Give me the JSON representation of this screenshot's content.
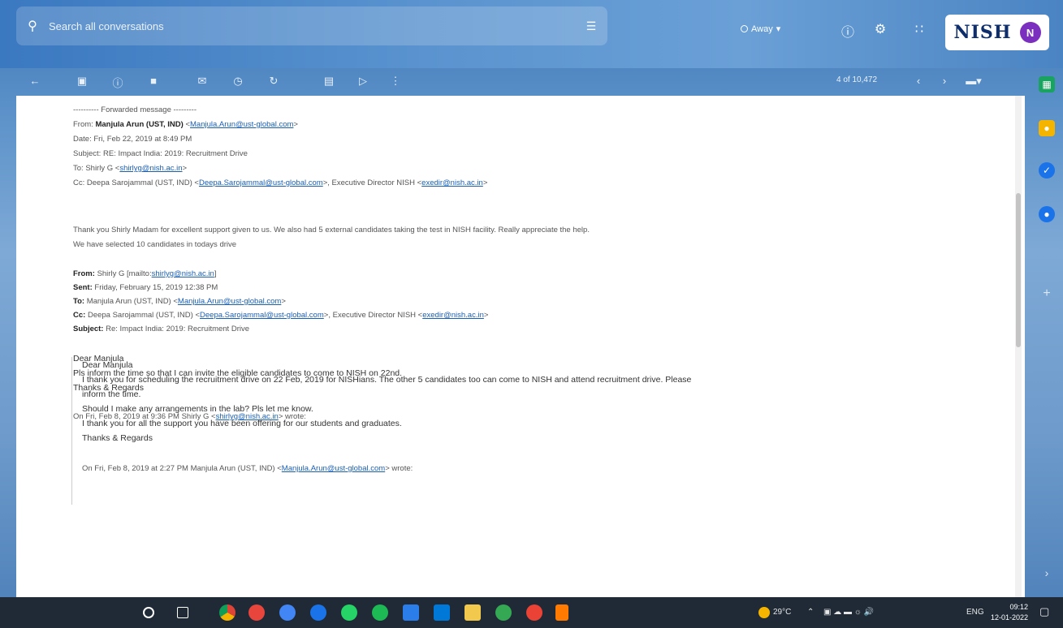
{
  "search": {
    "placeholder": "Search all conversations"
  },
  "status": {
    "label": "Away"
  },
  "brand": {
    "logo_text": "NISH",
    "avatar_letter": "N"
  },
  "toolbar": {
    "pager": "4 of 10,472"
  },
  "header": {
    "forward_marker": "---------- Forwarded message ---------",
    "from_label": "From:",
    "from_name": "Manjula Arun (UST, IND)",
    "from_email": "Manjula.Arun@ust-global.com",
    "date_label": "Date:",
    "date_value": "Fri, Feb 22, 2019 at 8:49 PM",
    "subject_label": "Subject:",
    "subject_value": "RE: Impact India: 2019: Recruitment Drive",
    "to_label": "To:",
    "to_name": "Shirly G",
    "to_email": "shirlyg@nish.ac.in",
    "cc_label": "Cc:",
    "cc_name": "Deepa Sarojammal (UST, IND)",
    "cc_email": "Deepa.Sarojammal@ust-global.com",
    "cc_rest": ", Executive Director NISH",
    "cc_email2": "exedir@nish.ac.in"
  },
  "body": {
    "line1": "Thank you Shirly Madam for excellent support given to us. We also had 5 external candidates taking the test in NISH facility. Really appreciate the help.",
    "line2": "We have selected 10 candidates in todays drive"
  },
  "reply": {
    "from_label": "From:",
    "from_value": "Shirly G [mailto:",
    "from_email": "shirlyg@nish.ac.in",
    "from_end": "]",
    "sent_label": "Sent:",
    "sent_value": "Friday, February 15, 2019 12:38 PM",
    "to_label": "To:",
    "to_value": "Manjula Arun (UST, IND)",
    "to_email": "Manjula.Arun@ust-global.com",
    "cc_label": "Cc:",
    "cc_value": "Deepa Sarojammal (UST, IND)",
    "cc_email": "Deepa.Sarojammal@ust-global.com",
    "cc_rest": ", Executive Director NISH",
    "cc_email2": "exedir@nish.ac.in",
    "subject_label": "Subject:",
    "subject_value": "Re: Impact India: 2019: Recruitment Drive",
    "greeting": "Dear Manjula",
    "text": "Pls inform the time so that I can invite the eligible candidates to come to NISH on 22nd.",
    "signoff": "Thanks & Regards"
  },
  "quote1": {
    "attrib_start": "On Fri, Feb 8, 2019 at 9:36 PM Shirly G <",
    "attrib_email": "shirlyg@nish.ac.in",
    "attrib_end": "> wrote:",
    "greeting": "Dear Manjula",
    "line1": "I thank you for scheduling the recruitment drive on 22 Feb, 2019 for NISHians. The other 5 candidates too can come to NISH and attend recruitment drive. Please",
    "line2": "inform the time.",
    "line3": "Should I make any arrangements in the lab? Pls let me know.",
    "line4": "I thank you for all the support you have been offering for our students and graduates.",
    "signoff": "Thanks & Regards"
  },
  "quote2": {
    "attrib_start": "On Fri, Feb 8, 2019 at 2:27 PM Manjula Arun (UST, IND) <",
    "attrib_email": "Manjula.Arun@ust-global.com",
    "attrib_end": "> wrote:"
  },
  "taskbar": {
    "weather": "29°C",
    "lang": "ENG",
    "time": "09:12",
    "date": "12-01-2022"
  }
}
